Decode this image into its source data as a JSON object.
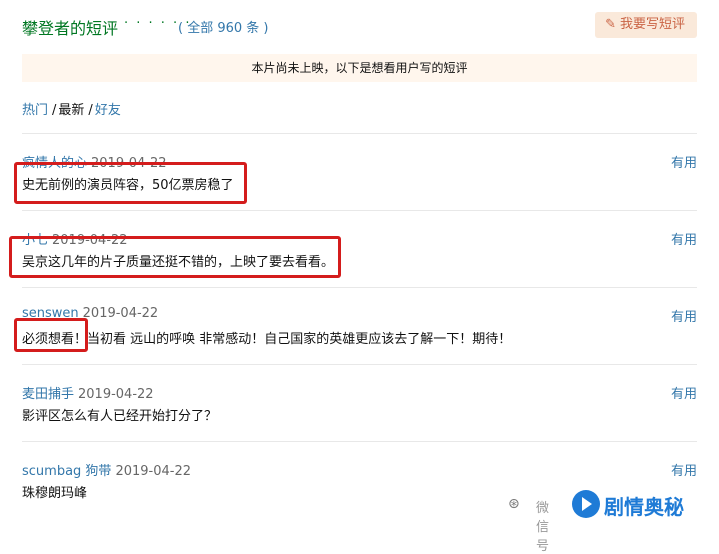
{
  "header": {
    "title": "攀登者的短评",
    "dots": "· · · · · ·",
    "count": "( 全部 960 条 )",
    "write_button": "我要写短评"
  },
  "notice": "本片尚未上映，以下是想看用户写的短评",
  "tabs": [
    {
      "label": "热门",
      "sep": "/"
    },
    {
      "label": "最新",
      "sep": "/"
    },
    {
      "label": "好友",
      "sep": ""
    }
  ],
  "comments": [
    {
      "user": "疯情人的心",
      "date": "2019-04-22",
      "useful": "有用",
      "text": "史无前例的演员阵容，50亿票房稳了"
    },
    {
      "user": "小七",
      "date": "2019-04-22",
      "useful": "有用",
      "text": "吴京这几年的片子质量还挺不错的，上映了要去看看。"
    },
    {
      "user": "senswen",
      "date": "2019-04-22",
      "useful": "有用",
      "text": "必须想看！当初看 远山的呼唤 非常感动！自己国家的英雄更应该去了解一下！期待！"
    },
    {
      "user": "麦田捕手",
      "date": "2019-04-22",
      "useful": "有用",
      "text": "影评区怎么有人已经开始打分了？"
    },
    {
      "user": "scumbag 狗带",
      "date": "2019-04-22",
      "useful": "有用",
      "text": "珠穆朗玛峰"
    }
  ],
  "watermark": {
    "small": "微信号",
    "brand": "剧情奥秘"
  },
  "colors": {
    "title_green": "#007722",
    "link_blue": "#37a",
    "highlight_red": "#d41c1c",
    "button_bg": "#fae9da",
    "notice_bg": "#fff6ed",
    "brand_blue": "#1f7bd6"
  }
}
